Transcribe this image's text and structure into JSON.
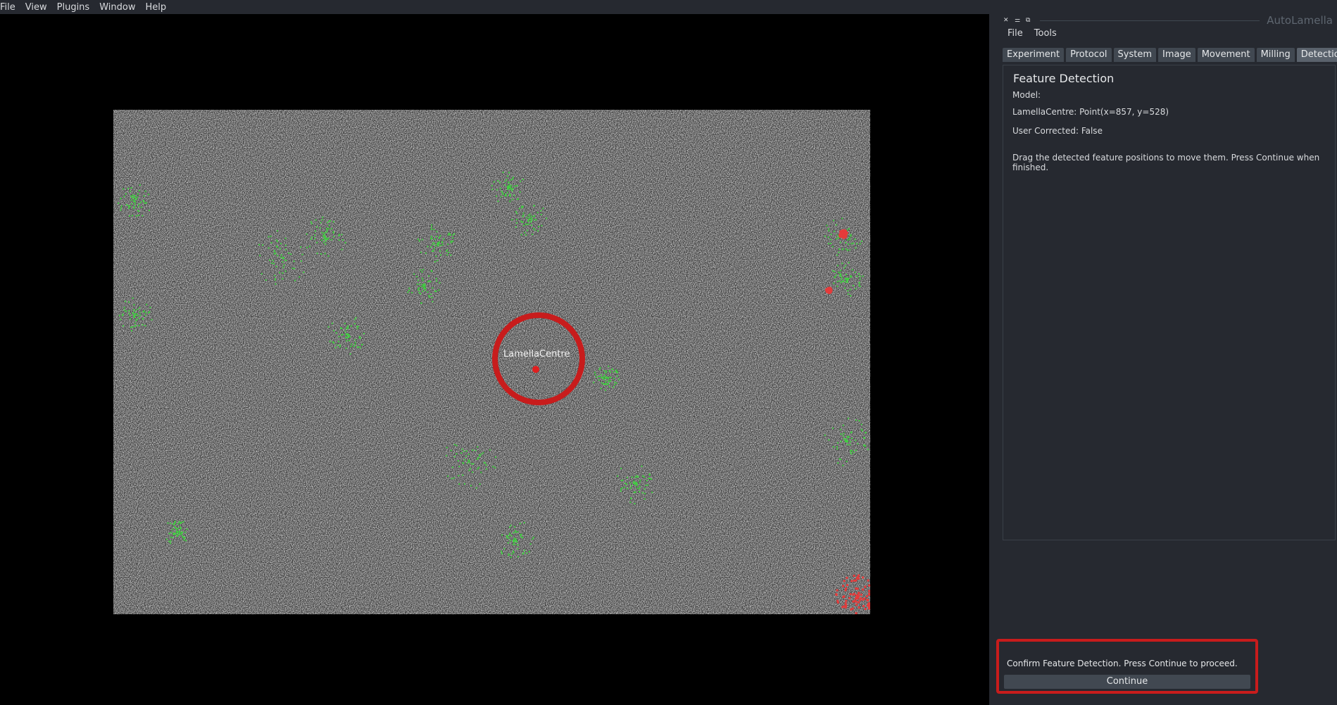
{
  "menubar": {
    "items": [
      "File",
      "View",
      "Plugins",
      "Window",
      "Help"
    ]
  },
  "viewer": {
    "feature_label": "LamellaCentre",
    "colors": {
      "marker": "#c81c1c",
      "overlay_green": "#3fd13f",
      "overlay_red": "#e53b3b"
    }
  },
  "dock": {
    "title": "AutoLamella",
    "title_controls": [
      "close-icon",
      "float-icon",
      "dock-restore-icon"
    ],
    "menu": [
      "File",
      "Tools"
    ],
    "tabs": [
      "Experiment",
      "Protocol",
      "System",
      "Image",
      "Movement",
      "Milling",
      "Detection"
    ],
    "active_tab": "Detection",
    "panel": {
      "title": "Feature Detection",
      "model_label": "Model:",
      "feature_point": "LamellaCentre: Point(x=857, y=528)",
      "user_corrected": "User Corrected: False",
      "instructions": "Drag the detected feature positions to move them. Press Continue when finished."
    }
  },
  "confirm": {
    "message": "Confirm Feature Detection. Press Continue to proceed.",
    "continue_label": "Continue"
  },
  "colors": {
    "background": "#262930",
    "tab": "#414851",
    "tab_active": "#5a626c",
    "highlight": "#c81c1c"
  }
}
